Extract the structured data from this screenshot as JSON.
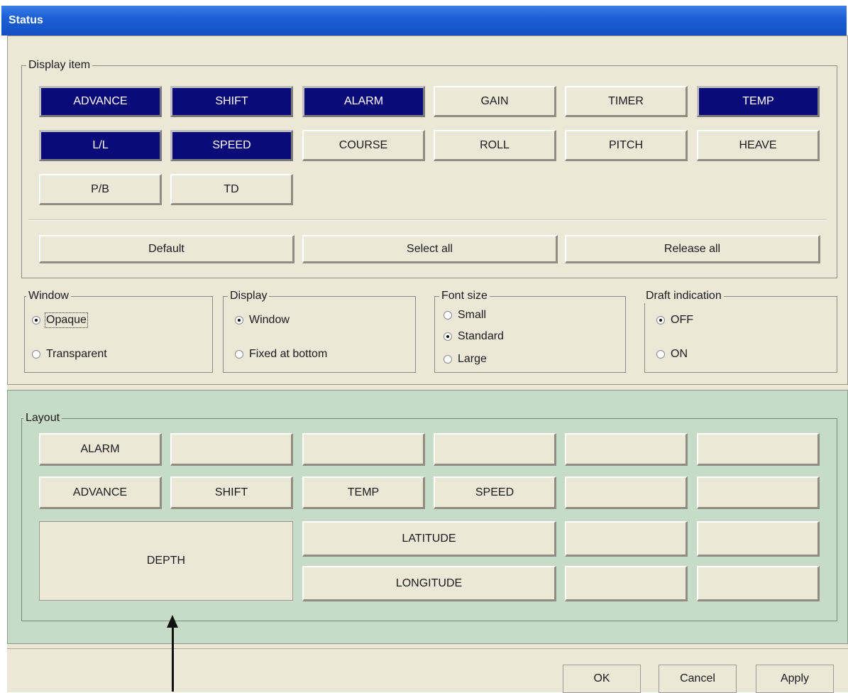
{
  "window": {
    "title": "Status"
  },
  "display_item": {
    "legend": "Display item",
    "buttons": [
      {
        "label": "ADVANCE",
        "selected": true
      },
      {
        "label": "SHIFT",
        "selected": true
      },
      {
        "label": "ALARM",
        "selected": true
      },
      {
        "label": "GAIN",
        "selected": false
      },
      {
        "label": "TIMER",
        "selected": false
      },
      {
        "label": "TEMP",
        "selected": true
      },
      {
        "label": "L/L",
        "selected": true
      },
      {
        "label": "SPEED",
        "selected": true
      },
      {
        "label": "COURSE",
        "selected": false
      },
      {
        "label": "ROLL",
        "selected": false
      },
      {
        "label": "PITCH",
        "selected": false
      },
      {
        "label": "HEAVE",
        "selected": false
      },
      {
        "label": "P/B",
        "selected": false
      },
      {
        "label": "TD",
        "selected": false
      }
    ],
    "actions": {
      "default": "Default",
      "select_all": "Select all",
      "release_all": "Release all"
    }
  },
  "window_group": {
    "legend": "Window",
    "options": [
      "Opaque",
      "Transparent"
    ],
    "selected": "Opaque"
  },
  "display_group": {
    "legend": "Display",
    "options": [
      "Window",
      "Fixed at bottom"
    ],
    "selected": "Window"
  },
  "font_group": {
    "legend": "Font size",
    "options": [
      "Small",
      "Standard",
      "Large"
    ],
    "selected": "Standard"
  },
  "draft_group": {
    "legend": "Draft indication",
    "options": [
      "OFF",
      "ON"
    ],
    "selected": "OFF"
  },
  "layout": {
    "legend": "Layout",
    "row1": [
      "ALARM",
      "",
      "",
      "",
      "",
      ""
    ],
    "row2": [
      "ADVANCE",
      "SHIFT",
      "TEMP",
      "SPEED",
      "",
      ""
    ],
    "depth": "DEPTH",
    "latitude": "LATITUDE",
    "longitude": "LONGITUDE"
  },
  "footer": {
    "ok": "OK",
    "cancel": "Cancel",
    "apply": "Apply"
  },
  "colors": {
    "selected_button": "#0a0a78",
    "layout_panel": "#c6dcc6",
    "title_bar": "#1b5fd6"
  }
}
